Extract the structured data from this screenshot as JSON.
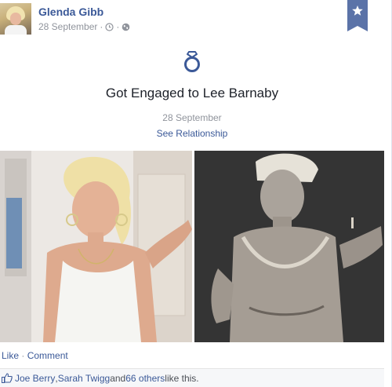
{
  "post": {
    "author": "Glenda Gibb",
    "date": "28 September",
    "meta_sep": " · "
  },
  "event": {
    "icon": "ring-icon",
    "title": "Got Engaged to Lee Barnaby",
    "date": "28 September",
    "link": "See Relationship"
  },
  "actions": {
    "like": "Like",
    "sep": " · ",
    "comment": "Comment"
  },
  "likes": {
    "person1": "Joe Berry",
    "sep": ", ",
    "person2": "Sarah Twigg",
    "and": " and ",
    "others": "66 others",
    "suffix": " like this."
  },
  "colors": {
    "link": "#3b5998",
    "bookmark": "#5b73a8",
    "ring": "#3b5998",
    "muted": "#90949c"
  }
}
